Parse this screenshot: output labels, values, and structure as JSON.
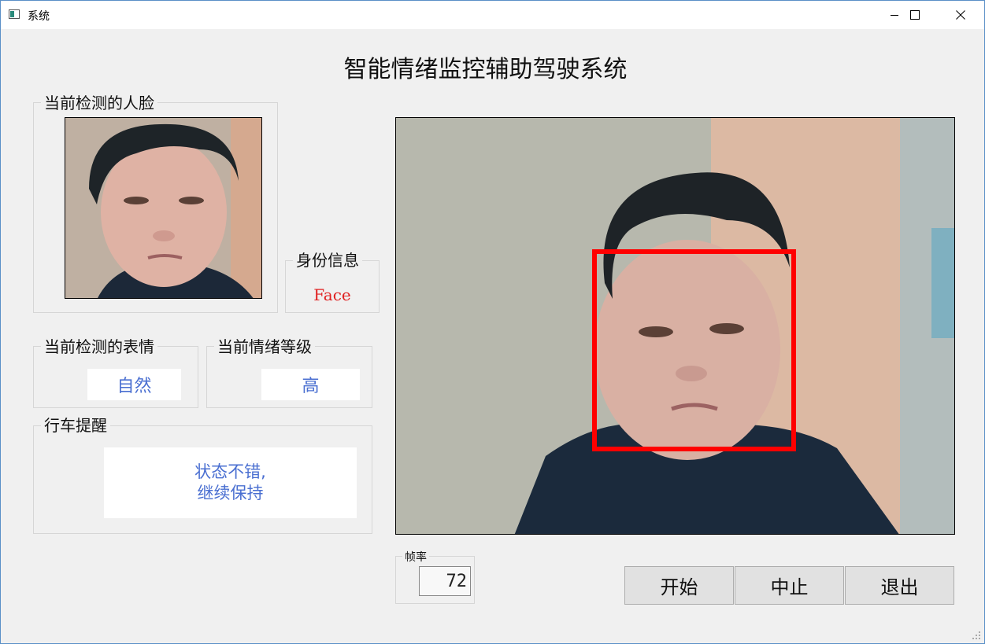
{
  "window": {
    "title": "系统"
  },
  "app_title": "智能情绪监控辅助驾驶系统",
  "face_panel": {
    "legend": "当前检测的人脸"
  },
  "identity": {
    "legend": "身份信息",
    "value": "Face"
  },
  "expression": {
    "legend": "当前检测的表情",
    "value": "自然"
  },
  "emotion_level": {
    "legend": "当前情绪等级",
    "value": "高"
  },
  "reminder": {
    "legend": "行车提醒",
    "line1": "状态不错,",
    "line2": "继续保持"
  },
  "fps": {
    "legend": "帧率",
    "value": "72"
  },
  "buttons": {
    "start": "开始",
    "stop": "中止",
    "exit": "退出"
  },
  "colors": {
    "value_text": "#4a6fd1",
    "identity_text": "#e02020",
    "face_box": "#ff0000"
  },
  "icons": [
    "app-window-icon",
    "minimize-icon",
    "maximize-icon",
    "close-icon",
    "resize-grip-icon"
  ]
}
